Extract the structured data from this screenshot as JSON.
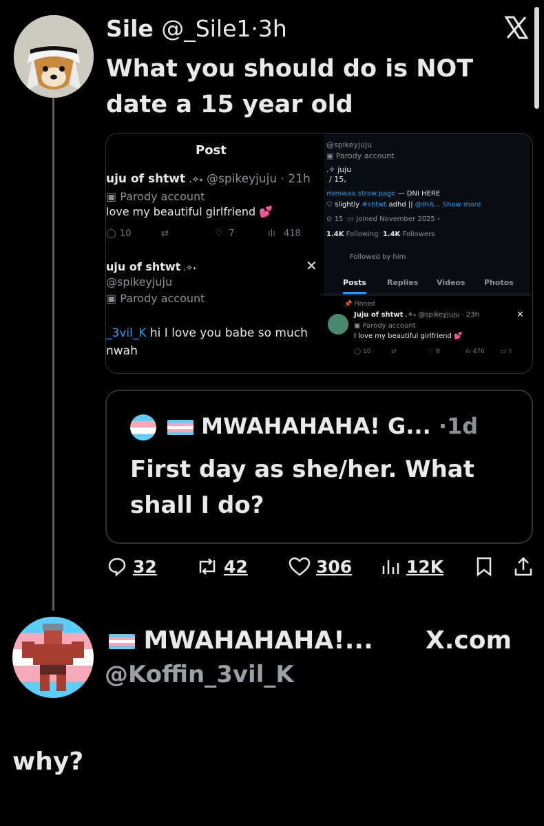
{
  "tweet": {
    "name": "Sile",
    "handle": "@_Sile1",
    "dot": "·",
    "time": "3h",
    "text": "What you should do is NOT date a 15 year old",
    "close_icon": "x-logo-icon"
  },
  "screenshot_left": {
    "header": "Post",
    "post1": {
      "name": "uju of shtwt",
      "handle": "@spikeyjuju · 21h",
      "badge": "Parody account",
      "text": "love my beautiful girlfriend 💕",
      "replies": "10",
      "likes": "7",
      "views": "418"
    },
    "post2": {
      "name": "uju of shtwt",
      "handle": "@spikeyjuju",
      "badge": "Parody account",
      "mention": "_3vil_K",
      "text": " hi I love you babe so much",
      "text2": "nwah"
    }
  },
  "screenshot_right": {
    "handle": "@spikeyjuju",
    "badge": "Parody account",
    "bio1": "juju",
    "bio2": "/ 15,",
    "link": "meowaa.straw.page",
    "link_suffix": " — DNI HERE",
    "bio3_pre": "slightly ",
    "bio3_tag": "#shtwt",
    "bio3_mid": " adhd || ",
    "bio3_at": "@IHA...",
    "show_more": "Show more",
    "loc": "15",
    "joined": "Joined November 2025",
    "following_count": "1.4K",
    "following_label": " Following",
    "followers_count": "1.4K",
    "followers_label": " Followers",
    "followed_by": "Followed by him",
    "tabs": [
      "Posts",
      "Replies",
      "Videos",
      "Photos"
    ],
    "pinned": "Pinned",
    "pinned_name": "Juju of shtwt",
    "pinned_handle": "@spikeyjuju · 23h",
    "pinned_badge": "Parody account",
    "pinned_text": "I love my beautiful girlfriend 💕",
    "pinned_replies": "10",
    "pinned_likes": "8",
    "pinned_views": "476"
  },
  "quote": {
    "name": "MWAHAHAHA! G...",
    "dot": "·",
    "time": "1d",
    "text": "First day as she/her. What shall I do?"
  },
  "actions": {
    "replies": "32",
    "reposts": "42",
    "likes": "306",
    "views": "12K"
  },
  "reply": {
    "name": "MWAHAHAHA!...",
    "handle": "@Koffin_3vil_K",
    "site": "X.com",
    "text": "why?"
  }
}
